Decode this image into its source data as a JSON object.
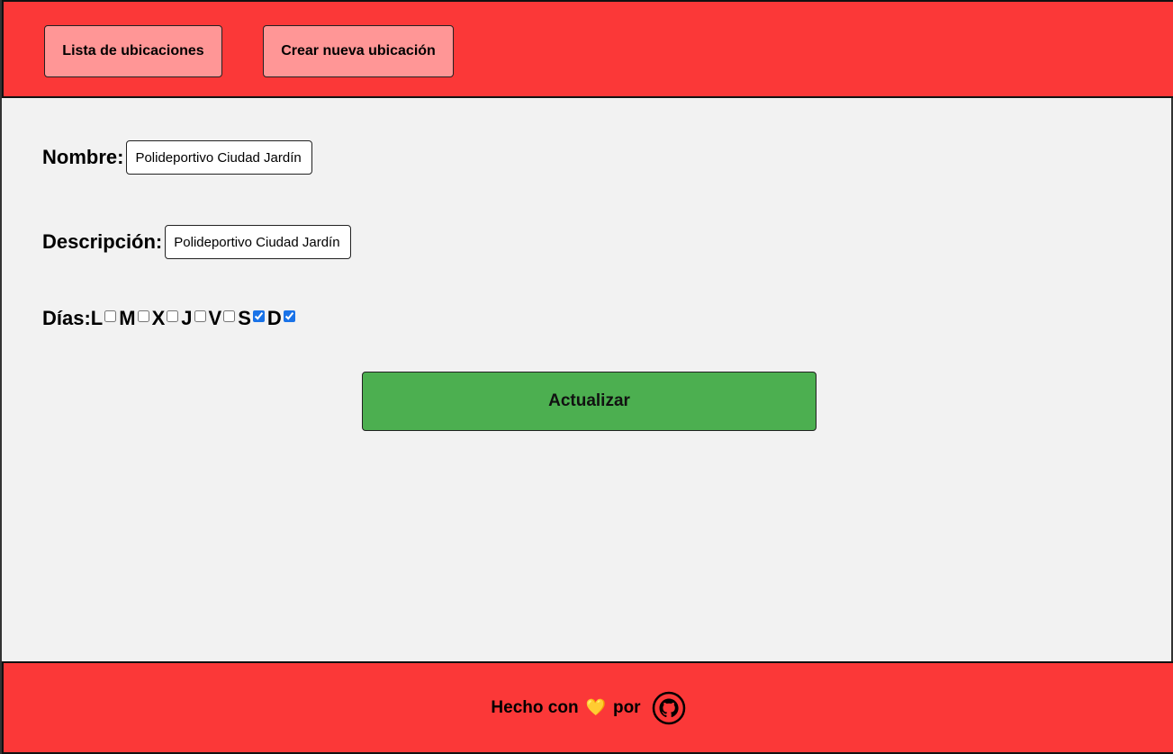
{
  "header": {
    "nav": {
      "list_label": "Lista de ubicaciones",
      "create_label": "Crear nueva ubicación"
    }
  },
  "form": {
    "name": {
      "label": "Nombre:",
      "value": "Polideportivo Ciudad Jardín"
    },
    "description": {
      "label": "Descripción:",
      "value": "Polideportivo Ciudad Jardín"
    },
    "days": {
      "label": "Días:",
      "items": [
        {
          "letter": "L",
          "checked": false
        },
        {
          "letter": "M",
          "checked": false
        },
        {
          "letter": "X",
          "checked": false
        },
        {
          "letter": "J",
          "checked": false
        },
        {
          "letter": "V",
          "checked": false
        },
        {
          "letter": "S",
          "checked": true
        },
        {
          "letter": "D",
          "checked": true
        }
      ]
    },
    "submit_label": "Actualizar"
  },
  "footer": {
    "prefix": "Hecho con",
    "heart": "💛",
    "suffix": "por",
    "github_icon": "github-icon"
  },
  "colors": {
    "header_bg": "#fb3838",
    "nav_button_bg": "#ff9696",
    "submit_bg": "#4caf50",
    "page_bg": "#f2f2f2",
    "checkbox_accent": "#1a73e8"
  }
}
